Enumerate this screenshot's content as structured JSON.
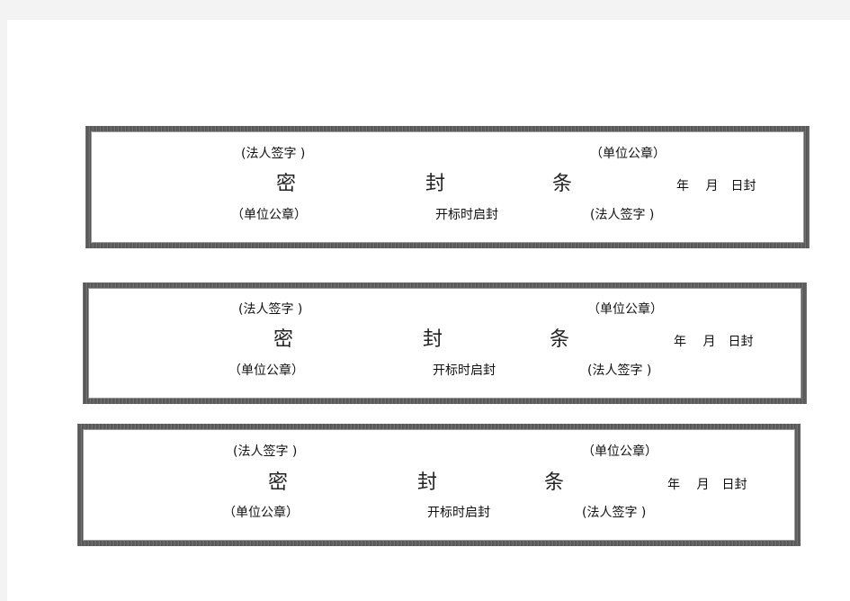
{
  "document": {
    "seal_strips": [
      {
        "top_left_label": "(法人签字 )",
        "top_right_label": "（单位公章）",
        "title_chars": [
          "密",
          "封",
          "条"
        ],
        "date_label": "年　 月　日封",
        "bottom_left_label": "（单位公章）",
        "bottom_center_label": "开标时启封",
        "bottom_right_label": "(法人签字 )"
      },
      {
        "top_left_label": "(法人签字 )",
        "top_right_label": "（单位公章）",
        "title_chars": [
          "密",
          "封",
          "条"
        ],
        "date_label": "年　 月　日封",
        "bottom_left_label": "（单位公章）",
        "bottom_center_label": "开标时启封",
        "bottom_right_label": "(法人签字 )"
      },
      {
        "top_left_label": "(法人签字 )",
        "top_right_label": "（单位公章）",
        "title_chars": [
          "密",
          "封",
          "条"
        ],
        "date_label": "年　 月　日封",
        "bottom_left_label": "（单位公章）",
        "bottom_center_label": "开标时启封",
        "bottom_right_label": "(法人签字 )"
      }
    ]
  }
}
